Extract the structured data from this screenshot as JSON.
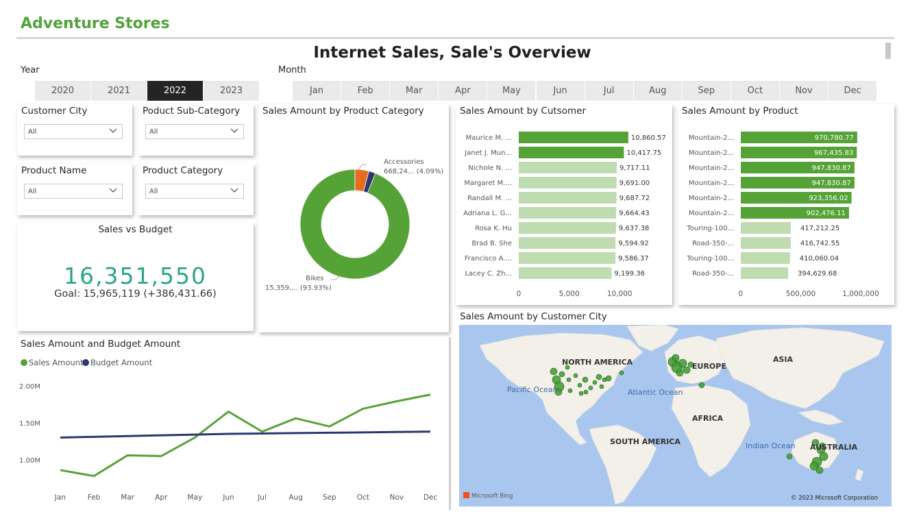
{
  "app": {
    "brand": "Adventure Stores",
    "title": "Internet Sales, Sale's Overview"
  },
  "colors": {
    "brand": "#53a33c",
    "sales": "#55a337",
    "budget": "#2b376e",
    "bar_light": "#bfdcb0",
    "kpi": "#2aa58a",
    "accessories": "#e66c1f",
    "third_slice": "#2b376e"
  },
  "year_slicer": {
    "label": "Year",
    "options": [
      "2020",
      "2021",
      "2022",
      "2023"
    ],
    "selected": "2022"
  },
  "month_slicer": {
    "label": "Month",
    "options": [
      "Jan",
      "Feb",
      "Mar",
      "Apr",
      "May",
      "Jun",
      "Jul",
      "Aug",
      "Sep",
      "Oct",
      "Nov",
      "Dec"
    ]
  },
  "filters": [
    {
      "label": "Customer City",
      "value": "All"
    },
    {
      "label": "Poduct Sub-Category",
      "value": "All"
    },
    {
      "label": "Product Name",
      "value": "All"
    },
    {
      "label": "Product Category",
      "value": "All"
    }
  ],
  "kpi": {
    "title": "Sales vs Budget",
    "value": "16,351,550",
    "goal": "Goal: 15,965,119 (+386,431.66)"
  },
  "donut": {
    "title": "Sales Amount by Product Category",
    "chart_data": {
      "type": "pie",
      "slices": [
        {
          "name": "Bikes",
          "value": 93.93,
          "label": "Bikes",
          "value_label": "15,359,... (93.93%)"
        },
        {
          "name": "Accessories",
          "value": 4.09,
          "label": "Accessories",
          "value_label": "668,24... (4.09%)"
        },
        {
          "name": "",
          "value": 1.98,
          "label": "",
          "value_label": ""
        }
      ]
    }
  },
  "customer_bars": {
    "title": "Sales Amount by Cutsomer",
    "chart_data": {
      "type": "bar",
      "orientation": "horizontal",
      "categories": [
        "Maurice M. ...",
        "Janet J. Mun...",
        "Nichole N. ...",
        "Margaret M....",
        "Randall M. ...",
        "Adriana L. G...",
        "Rosa K. Hu",
        "Brad B. She",
        "Francisco A....",
        "Lacey C. Zh..."
      ],
      "values": [
        10860.57,
        10417.75,
        9717.11,
        9691.0,
        9687.72,
        9664.43,
        9637.38,
        9594.92,
        9586.37,
        9199.36
      ],
      "value_labels": [
        "10,860.57",
        "10,417.75",
        "9,717.11",
        "9,691.00",
        "9,687.72",
        "9,664.43",
        "9,637.38",
        "9,594.92",
        "9,586.37",
        "9,199.36"
      ],
      "highlighted": [
        true,
        true,
        false,
        false,
        false,
        false,
        false,
        false,
        false,
        false
      ],
      "xlim": [
        0,
        12500
      ],
      "xticks": [
        0,
        5000,
        10000
      ],
      "xtick_labels": [
        "0",
        "5,000",
        "10,000"
      ]
    }
  },
  "product_bars": {
    "title": "Sales Amount by Product",
    "chart_data": {
      "type": "bar",
      "orientation": "horizontal",
      "categories": [
        "Mountain-2...",
        "Mountain-2...",
        "Mountain-2...",
        "Mountain-2...",
        "Mountain-2...",
        "Mountain-2...",
        "Touring-100...",
        "Road-350-...",
        "Touring-100...",
        "Road-350-..."
      ],
      "values": [
        970780.77,
        967435.83,
        947830.87,
        947830.87,
        923356.02,
        902476.11,
        417212.25,
        416742.55,
        410060.04,
        394629.68
      ],
      "value_labels": [
        "970,780.77",
        "967,435.83",
        "947,830.87",
        "947,830.87",
        "923,356.02",
        "902,476.11",
        "417,212.25",
        "416,742.55",
        "410,060.04",
        "394,629.68"
      ],
      "highlighted": [
        true,
        true,
        true,
        true,
        true,
        true,
        false,
        false,
        false,
        false
      ],
      "xlim": [
        0,
        1200000
      ],
      "xticks": [
        0,
        500000,
        1000000
      ],
      "xtick_labels": [
        "0",
        "500,000",
        "1,000,000"
      ]
    }
  },
  "line_chart": {
    "title": "Sales Amount and Budget Amount",
    "chart_data": {
      "type": "line",
      "categories": [
        "Jan",
        "Feb",
        "Mar",
        "Apr",
        "May",
        "Jun",
        "Jul",
        "Aug",
        "Sep",
        "Oct",
        "Nov",
        "Dec"
      ],
      "series": [
        {
          "name": "Sales Amount",
          "values": [
            0.86,
            0.78,
            1.06,
            1.05,
            1.3,
            1.65,
            1.38,
            1.56,
            1.45,
            1.69,
            1.79,
            1.88
          ]
        },
        {
          "name": "Budget Amount",
          "values": [
            1.3,
            1.31,
            1.32,
            1.33,
            1.34,
            1.35,
            1.355,
            1.36,
            1.365,
            1.37,
            1.375,
            1.38
          ]
        }
      ],
      "y_unit": "M",
      "ylim": [
        0.6,
        2.1
      ],
      "yticks": [
        1.0,
        1.5,
        2.0
      ],
      "ytick_labels": [
        "1.00M",
        "1.50M",
        "2.00M"
      ]
    }
  },
  "map": {
    "title": "Sales Amount by Customer City",
    "continents": [
      "NORTH AMERICA",
      "EUROPE",
      "ASIA",
      "AFRICA",
      "SOUTH AMERICA",
      "AUSTRALIA"
    ],
    "oceans": [
      "Pacific Ocean",
      "Atlantic Ocean",
      "Indian Ocean"
    ],
    "credit": "Microsoft Bing",
    "copyright": "© 2023 Microsoft Corporation"
  }
}
